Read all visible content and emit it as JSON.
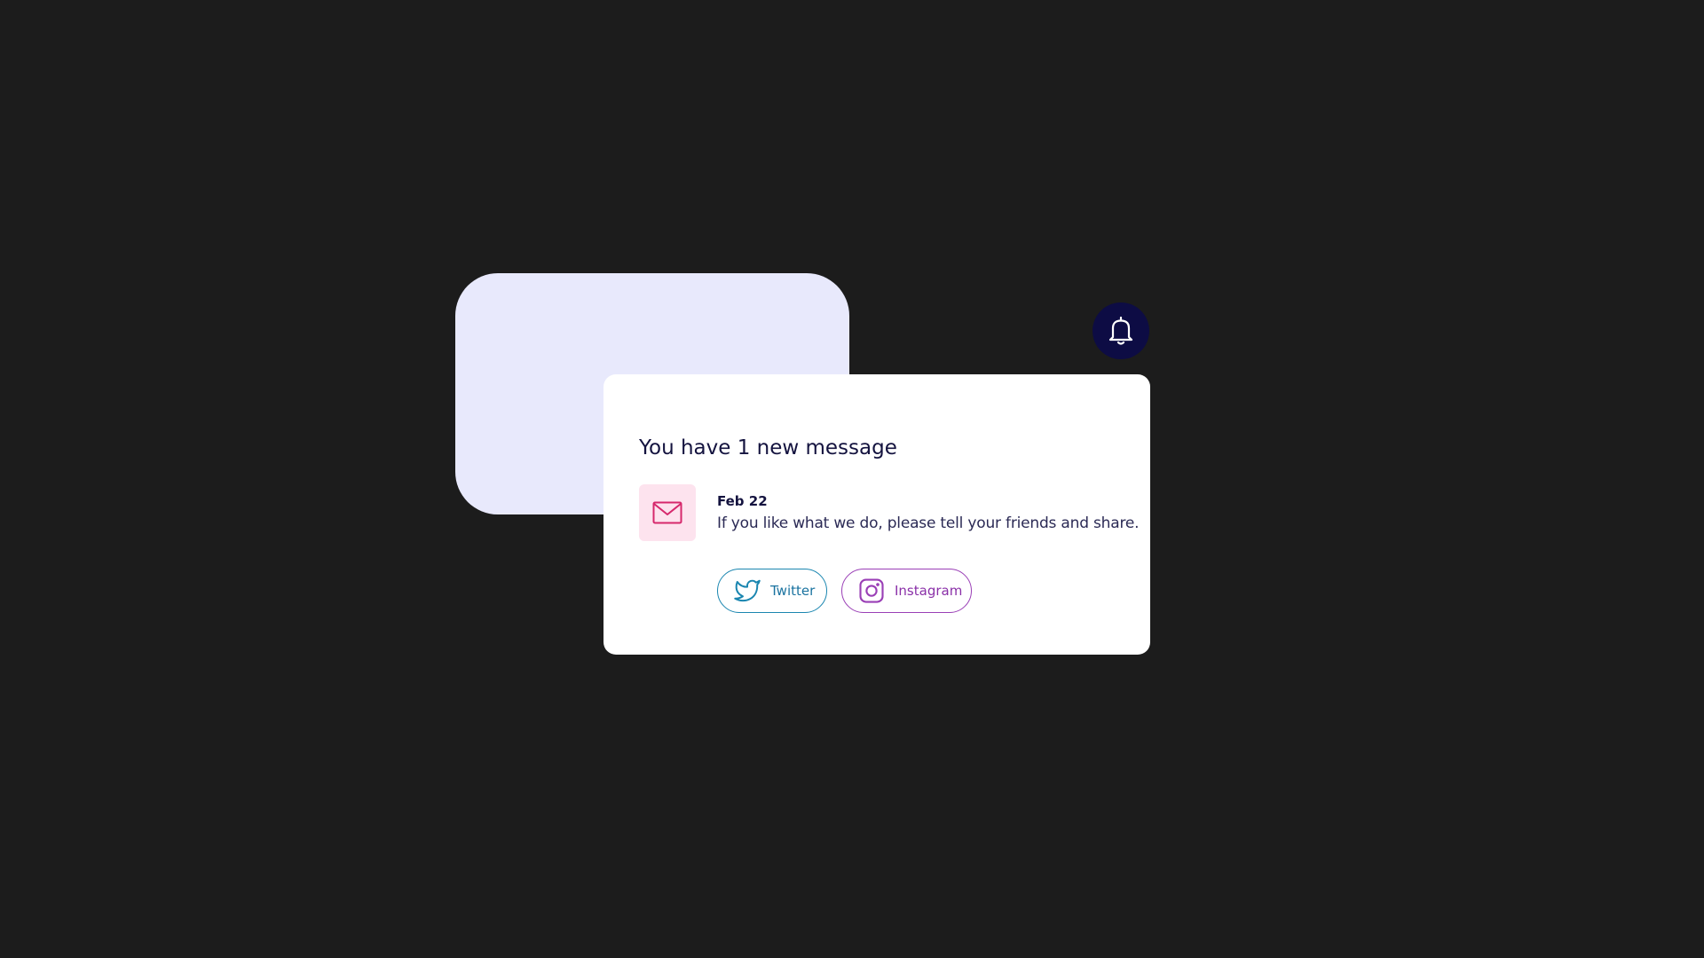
{
  "notification": {
    "title": "You have 1 new message",
    "message": {
      "date": "Feb 22",
      "text": "If you like what we do, please tell your friends and share."
    },
    "share_buttons": [
      {
        "label": "Twitter",
        "icon": "twitter-icon",
        "color": "#1a86b0"
      },
      {
        "label": "Instagram",
        "icon": "instagram-icon",
        "color": "#9a3fb6"
      }
    ]
  },
  "colors": {
    "background": "#1c1c1c",
    "backdrop_card": "#e8e9fc",
    "bell_badge": "#0d0c44",
    "mail_tile": "#fde3ee",
    "mail_icon": "#d6286c",
    "text_primary": "#14133f"
  },
  "icons": {
    "bell": "bell-icon",
    "mail": "mail-icon"
  }
}
